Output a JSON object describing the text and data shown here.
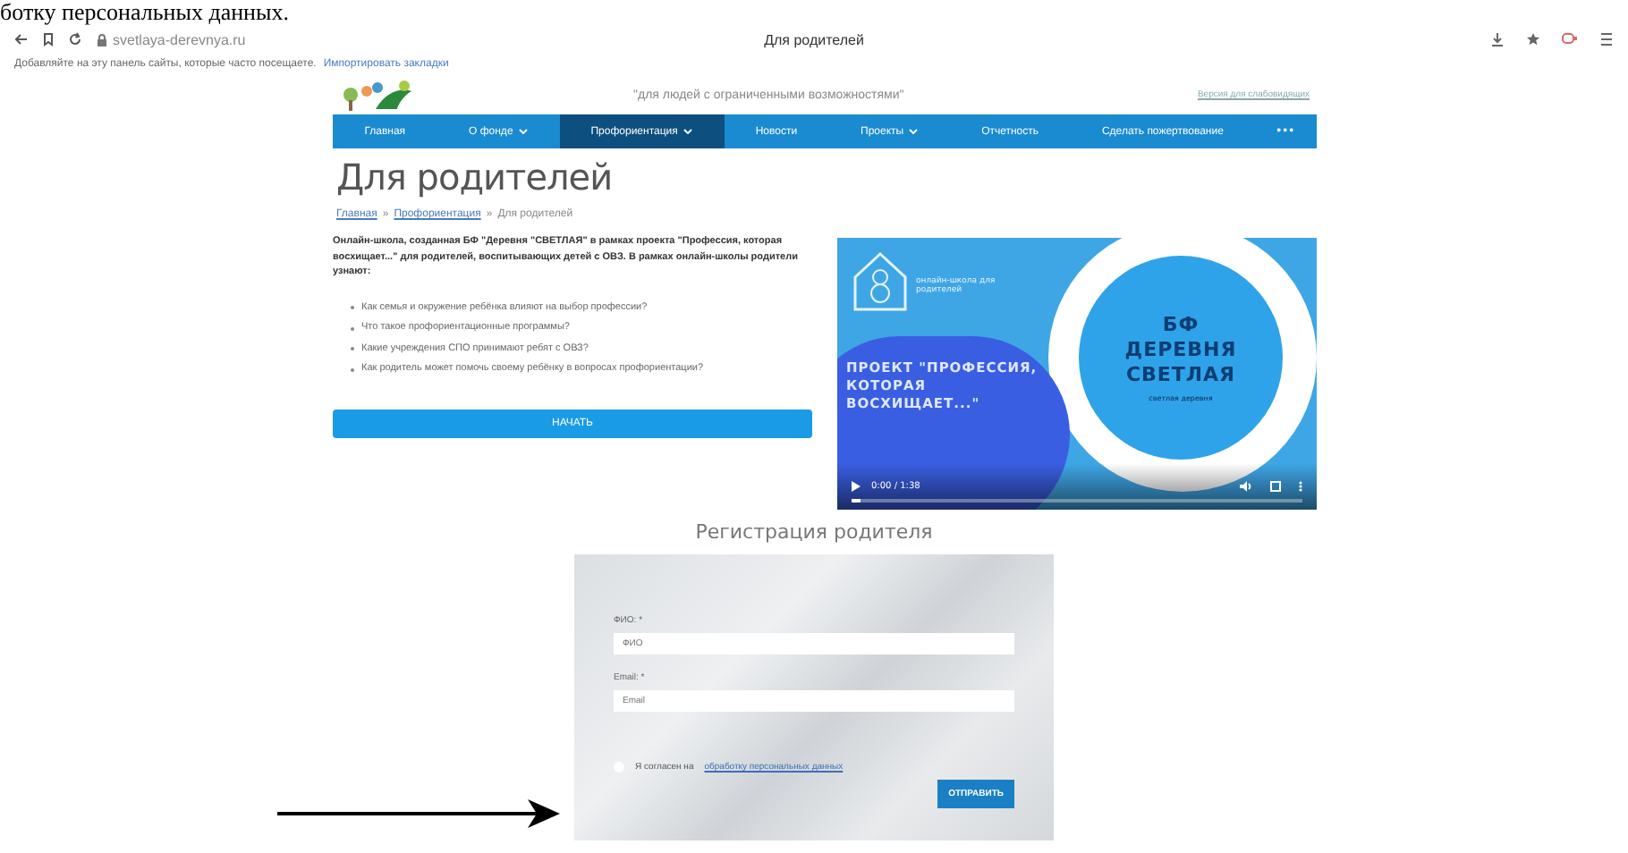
{
  "document_text": "ботку персональных данных.",
  "browser": {
    "address": "svetlaya-derevnya.ru",
    "tab_title": "Для родителей"
  },
  "bookmarks_bar": {
    "message": "Добавляйте на эту панель сайты, которые часто посещаете.",
    "link": "Импортировать закладки"
  },
  "site": {
    "tagline": "\"для людей с ограниченными возможностями\"",
    "top_link": "Версия для слабовидящих",
    "nav": [
      {
        "label": "Главная",
        "dropdown": false,
        "selected": false
      },
      {
        "label": "О фонде",
        "dropdown": true,
        "selected": false
      },
      {
        "label": "Профориентация",
        "dropdown": true,
        "selected": true
      },
      {
        "label": "Новости",
        "dropdown": false,
        "selected": false
      },
      {
        "label": "Проекты",
        "dropdown": true,
        "selected": false
      },
      {
        "label": "Отчетность",
        "dropdown": false,
        "selected": false
      },
      {
        "label": "Сделать пожертвование",
        "dropdown": false,
        "selected": false
      }
    ],
    "nav_more": "•••",
    "heading": "Для родителей",
    "breadcrumbs": [
      {
        "label": "Главная",
        "link": true
      },
      {
        "label": "Профориентация",
        "link": true
      },
      {
        "label": "Для родителей",
        "link": false
      }
    ],
    "breadcrumb_separator": "»"
  },
  "intro": "Онлайн-школа, созданная БФ \"Деревня \"СВЕТЛАЯ\" в рамках проекта \"Профессия, которая восхищает...\" для родителей, воспитывающих детей с ОВЗ. В рамках онлайн-школы родители узнают:",
  "bullets": [
    "Как семья и окружение ребёнка влияют на выбор профессии?",
    "Что такое профориентационные программы?",
    "Какие учреждения СПО принимают ребят с ОВЗ?",
    "Как родитель может помочь своему ребёнку в вопросах профориентации?"
  ],
  "start_button": "НАЧАТЬ",
  "video": {
    "school_label": "онлайн-школа для родителей",
    "project_title": "ПРОЕКТ \"ПРОФЕССИЯ, КОТОРАЯ ВОСХИЩАЕТ...\"",
    "brand_title": "БФ ДЕРЕВНЯ СВЕТЛАЯ",
    "brand_subtitle": "светлая деревня",
    "time": "0:00 / 1:38",
    "level": 0.02
  },
  "registration": {
    "title": "Регистрация родителя",
    "fields": [
      {
        "label": "ФИО: *",
        "placeholder": "ФИО"
      },
      {
        "label": "Email: *",
        "placeholder": "Email"
      }
    ],
    "consent": {
      "text": "Я согласен на",
      "link": "обработку персональных данных",
      "checked": false
    },
    "submit": "ОТПРАВИТЬ"
  }
}
